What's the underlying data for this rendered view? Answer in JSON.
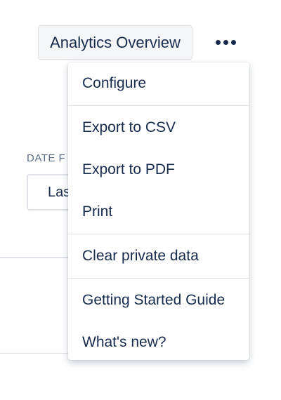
{
  "header": {
    "title": "Analytics Overview",
    "more_icon": "more-horizontal-icon"
  },
  "filters": {
    "date_label": "DATE F",
    "date_value": "Las"
  },
  "menu": {
    "items": [
      {
        "label": "Configure"
      },
      {
        "label": "Export to CSV"
      },
      {
        "label": "Export to PDF"
      },
      {
        "label": "Print"
      },
      {
        "label": "Clear private data"
      },
      {
        "label": "Getting Started Guide"
      },
      {
        "label": "What's new?"
      }
    ]
  },
  "colors": {
    "text": "#172b4d",
    "button_bg": "#f4f5f7",
    "border": "#dfe1e6",
    "muted": "#5e6c84"
  }
}
